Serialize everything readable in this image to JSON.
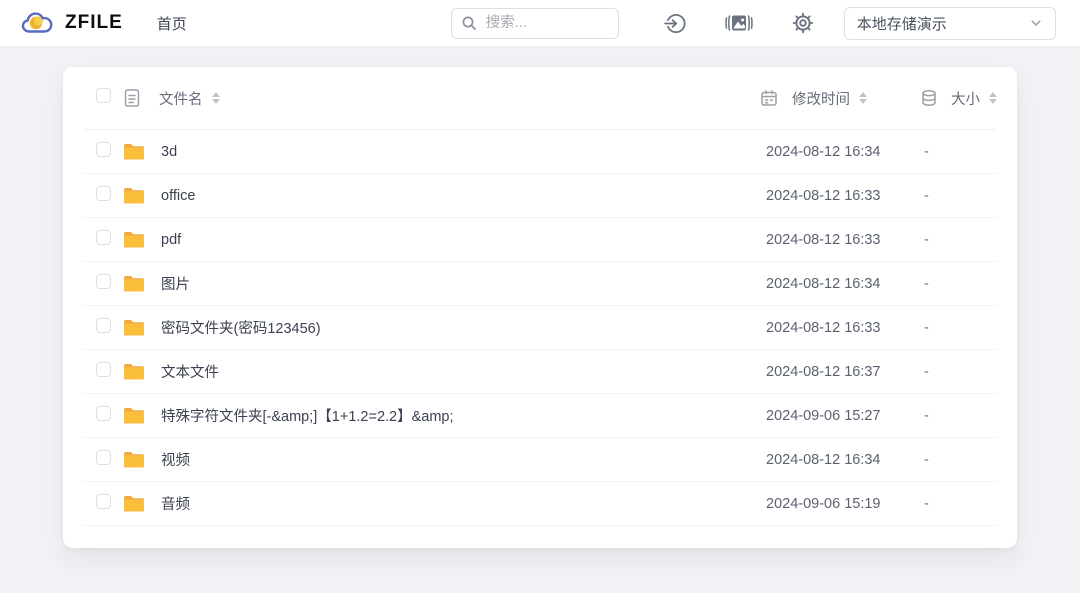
{
  "topbar": {
    "brand": "ZFILE",
    "nav_home": "首页",
    "search": {
      "placeholder": "搜索..."
    },
    "icon_names": {
      "logo": "cloud-logo-icon",
      "search": "search-icon",
      "login": "login-icon",
      "gallery": "gallery-mode-icon",
      "settings": "gear-icon",
      "select_arrow": "chevron-down-icon"
    },
    "storage_select": {
      "value": "本地存储演示"
    }
  },
  "file_table": {
    "headers": {
      "name": "文件名",
      "modified": "修改时间",
      "size": "大小"
    },
    "header_icons": {
      "name": "file-icon",
      "modified": "calendar-icon",
      "size": "database-icon"
    },
    "row_icon": "folder-icon",
    "rows": [
      {
        "name": "3d",
        "time": "2024-08-12 16:34",
        "size": "-"
      },
      {
        "name": "office",
        "time": "2024-08-12 16:33",
        "size": "-"
      },
      {
        "name": "pdf",
        "time": "2024-08-12 16:33",
        "size": "-"
      },
      {
        "name": "图片",
        "time": "2024-08-12 16:34",
        "size": "-"
      },
      {
        "name": "密码文件夹(密码123456)",
        "time": "2024-08-12 16:33",
        "size": "-"
      },
      {
        "name": "文本文件",
        "time": "2024-08-12 16:37",
        "size": "-"
      },
      {
        "name": "特殊字符文件夹[-&amp;]【1+1.2=2.2】&amp;",
        "time": "2024-09-06 15:27",
        "size": "-"
      },
      {
        "name": "视频",
        "time": "2024-08-12 16:34",
        "size": "-"
      },
      {
        "name": "音频",
        "time": "2024-09-06 15:19",
        "size": "-"
      }
    ]
  },
  "colors": {
    "folder": "#FBBE3C",
    "folder_dark": "#F2A93B",
    "brand_cloud": "#5B6AC0",
    "brand_sun": "#EFB02D",
    "icon_gray_table": "#9A9FA8",
    "icon_gray_topbar": "#6B7280",
    "background": "#F1F2F5",
    "row_border": "#F3F4F8"
  }
}
